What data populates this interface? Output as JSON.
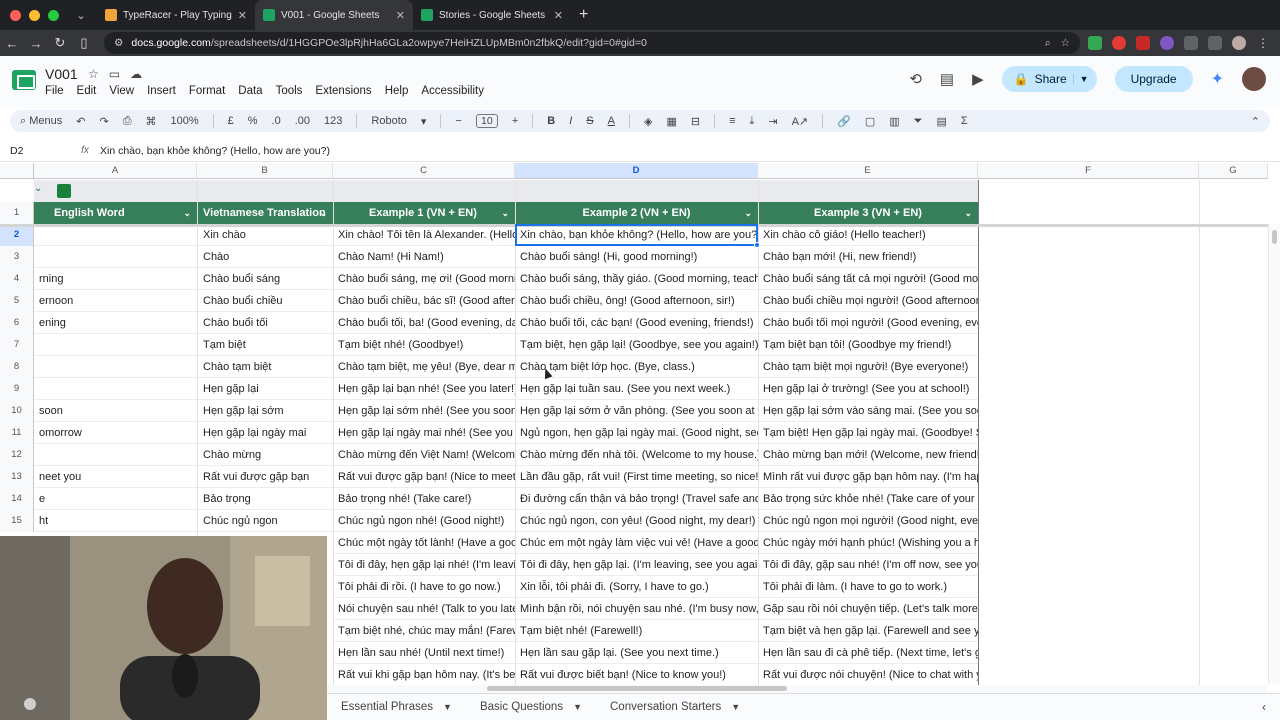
{
  "browser": {
    "tabs": [
      {
        "title": "TypeRacer - Play Typing Gam",
        "active": false,
        "favicon_color": "#f1a33b"
      },
      {
        "title": "V001 - Google Sheets",
        "active": true,
        "favicon_color": "#1ea362"
      },
      {
        "title": "Stories - Google Sheets",
        "active": false,
        "favicon_color": "#1ea362"
      }
    ],
    "url_host": "docs.google.com",
    "url_path": "/spreadsheets/d/1HGGPOe3lpRjhHa6GLa2owpye7HeiHZLUpMBm0n2fbkQ/edit?gid=0#gid=0"
  },
  "app": {
    "doc_title": "V001",
    "menu": [
      "File",
      "Edit",
      "View",
      "Insert",
      "Format",
      "Data",
      "Tools",
      "Extensions",
      "Help",
      "Accessibility"
    ],
    "share_label": "Share",
    "upgrade_label": "Upgrade"
  },
  "toolbar": {
    "menus_label": "Menus",
    "zoom": "100%",
    "currency": "£",
    "percent": "%",
    "dec_decrease": ".0",
    "dec_increase": ".00",
    "number_format": "123",
    "font": "Roboto",
    "font_size": "10"
  },
  "formula_bar": {
    "cell_ref": "D2",
    "fx": "fx",
    "value": "Xin chào, bạn khỏe không? (Hello, how are you?)"
  },
  "columns": [
    "A",
    "B",
    "C",
    "D",
    "E",
    "F",
    "G"
  ],
  "selected_column": "D",
  "table_headers": [
    "English Word",
    "Vietnamese Translation",
    "Example 1 (VN + EN)",
    "Example 2 (VN + EN)",
    "Example 3 (VN + EN)"
  ],
  "row_numbers": [
    "1",
    "2",
    "3",
    "4",
    "5",
    "6",
    "7",
    "8",
    "9",
    "10",
    "11",
    "12",
    "13",
    "14",
    "15"
  ],
  "rows": [
    [
      "",
      "Xin chào",
      "Xin chào! Tôi tên là Alexander. (Hello! My",
      "Xin chào, bạn khỏe không? (Hello, how are you?)",
      "Xin chào cô giáo! (Hello teacher!)"
    ],
    [
      "",
      "Chào",
      "Chào Nam! (Hi Nam!)",
      "Chào buổi sáng! (Hi, good morning!)",
      "Chào bạn mới! (Hi, new friend!)"
    ],
    [
      "rning",
      "Chào buổi sáng",
      "Chào buổi sáng, mẹ ơi! (Good morning, m",
      "Chào buổi sáng, thầy giáo. (Good morning, teacher.)",
      "Chào buổi sáng tất cả mọi người! (Good morning,"
    ],
    [
      "ernoon",
      "Chào buổi chiều",
      "Chào buổi chiều, bác sĩ! (Good afternoon",
      "Chào buổi chiều, ông! (Good afternoon, sir!)",
      "Chào buổi chiều mọi người! (Good afternoon, ever"
    ],
    [
      "ening",
      "Chào buổi tối",
      "Chào buổi tối, ba! (Good evening, dad!)",
      "Chào buổi tối, các bạn! (Good evening, friends!)",
      "Chào buổi tối mọi người! (Good evening, everyone"
    ],
    [
      "",
      "Tạm biệt",
      "Tạm biệt nhé! (Goodbye!)",
      "Tạm biệt, hẹn gặp lại! (Goodbye, see you again!)",
      "Tạm biệt bạn tôi! (Goodbye my friend!)"
    ],
    [
      "",
      "Chào tạm biệt",
      "Chào tạm biệt, mẹ yêu! (Bye, dear mom!)",
      "Chào tạm biệt lớp học. (Bye, class.)",
      "Chào tạm biệt mọi người! (Bye everyone!)"
    ],
    [
      "",
      "Hẹn gặp lại",
      "Hẹn gặp lại bạn nhé! (See you later!)",
      "Hẹn gặp lại tuần sau. (See you next week.)",
      "Hẹn gặp lại ở trường! (See you at school!)"
    ],
    [
      "soon",
      "Hẹn gặp lại sớm",
      "Hẹn gặp lại sớm nhé! (See you soon!)",
      "Hẹn gặp lại sớm ở văn phòng. (See you soon at the offi",
      "Hẹn gặp lại sớm vào sáng mai. (See you soon tom"
    ],
    [
      "omorrow",
      "Hẹn gặp lại ngày mai",
      "Hẹn gặp lại ngày mai nhé! (See you tomo",
      "Ngủ ngon, hẹn gặp lại ngày mai. (Good night, see you to",
      "Tạm biệt! Hẹn gặp lại ngày mai. (Goodbye! See yo"
    ],
    [
      "",
      "Chào mừng",
      "Chào mừng đến Việt Nam! (Welcome to V",
      "Chào mừng đến nhà tôi. (Welcome to my house.)",
      "Chào mừng bạn mới! (Welcome, new friend!)"
    ],
    [
      "neet you",
      "Rất vui được gặp bạn",
      "Rất vui được gặp bạn! (Nice to meet you!",
      "Lần đầu gặp, rất vui! (First time meeting, so nice!)",
      "Mình rất vui được gặp bạn hôm nay. (I'm happy to"
    ],
    [
      "e",
      "Bảo trọng",
      "Bảo trọng nhé! (Take care!)",
      "Đi đường cẩn thận và bảo trọng! (Travel safe and take c",
      "Bảo trọng sức khỏe nhé! (Take care of your health"
    ],
    [
      "ht",
      "Chúc ngủ ngon",
      "Chúc ngủ ngon nhé! (Good night!)",
      "Chúc ngủ ngon, con yêu! (Good night, my dear!)",
      "Chúc ngủ ngon mọi người! (Good night, everyone!)"
    ],
    [
      "",
      "",
      "Chúc một ngày tốt lành! (Have a good da",
      "Chúc em một ngày làm việc vui vẻ! (Have a good worke",
      "Chúc ngày mới hạnh phúc! (Wishing you a happy n"
    ],
    [
      "",
      "",
      "Tôi đi đây, hẹn gặp lại nhé! (I'm leaving, goo",
      "Tôi đi đây, hẹn gặp lại. (I'm leaving, see you again!)",
      "Tôi đi đây, gặp sau nhé! (I'm off now, see you later"
    ],
    [
      "",
      "",
      "Tôi phải đi rồi. (I have to go now.)",
      "Xin lỗi, tôi phải đi. (Sorry, I have to go.)",
      "Tôi phải đi làm. (I have to go to work.)"
    ],
    [
      "",
      "",
      "Nói chuyện sau nhé! (Talk to you later!)",
      "Mình bận rồi, nói chuyện sau nhé. (I'm busy now, talk la",
      "Gặp sau rồi nói chuyện tiếp. (Let's talk more later.)"
    ],
    [
      "",
      "",
      "Tạm biệt nhé, chúc may mắn! (Farewell, g",
      "Tạm biệt nhé! (Farewell!)",
      "Tạm biệt và hẹn gặp lại. (Farewell and see you aga"
    ],
    [
      "",
      "",
      "Hẹn lần sau nhé! (Until next time!)",
      "Hẹn lần sau gặp lại. (See you next time.)",
      "Hẹn lần sau đi cà phê tiếp. (Next time, let's grab c"
    ],
    [
      "",
      "",
      "Rất vui khi gặp bạn hôm nay. (It's been ni",
      "Rất vui được biết bạn! (Nice to know you!)",
      "Rất vui được nói chuyện! (Nice to chat with you!)"
    ]
  ],
  "sheet_tabs": [
    "Essential Phrases",
    "Basic Questions",
    "Conversation Starters"
  ],
  "colors": {
    "header_green": "#377e5b",
    "selection_blue": "#1a73e8"
  }
}
